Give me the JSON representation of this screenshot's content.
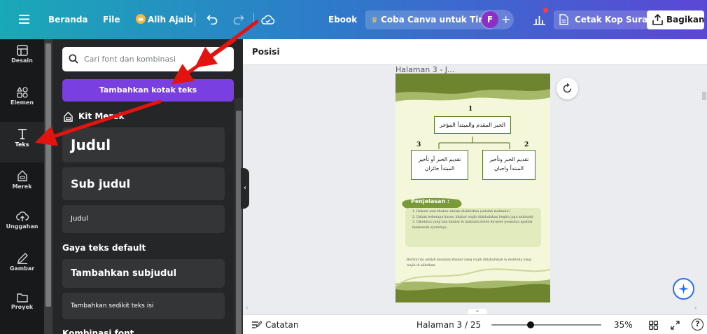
{
  "topbar": {
    "menu_icon": "hamburger-menu-icon",
    "home": "Beranda",
    "file": "File",
    "magic": "Alih Ajaib",
    "doc_type": "Ebook",
    "try_team": "Coba Canva untuk Tim",
    "avatar_initial": "F",
    "print": "Cetak Kop Surat",
    "share": "Bagikan"
  },
  "rail": [
    {
      "label": "Desain",
      "icon": "layout-icon"
    },
    {
      "label": "Elemen",
      "icon": "elements-icon"
    },
    {
      "label": "Teks",
      "icon": "text-icon"
    },
    {
      "label": "Merek",
      "icon": "brand-icon"
    },
    {
      "label": "Unggahan",
      "icon": "upload-icon"
    },
    {
      "label": "Gambar",
      "icon": "draw-icon"
    },
    {
      "label": "Proyek",
      "icon": "folder-icon"
    }
  ],
  "panel": {
    "search_placeholder": "Cari font dan kombinasi",
    "add_text_button": "Tambahkan kotak teks",
    "brand_kit": "Kit Merek",
    "brand_styles": [
      "Judul",
      "Sub judul",
      "Judul"
    ],
    "default_section": "Gaya teks default",
    "defaults": [
      "Tambahkan subjudul",
      "Tambahkan sedikit teks isi"
    ],
    "combo_section": "Kombinasi font"
  },
  "canvas": {
    "position_label": "Posisi",
    "page_header": "Halaman 3 - J...",
    "diagram": {
      "top_number": "1",
      "top_box": "الخبر المقدم والمبتدأ المؤخر",
      "left_number": "3",
      "left_box": [
        "تقديم الخبر أو تأخير",
        "المبتدأ جائزان"
      ],
      "right_number": "2",
      "right_box": [
        "تقديم الخبر وتأخير",
        "المبتدأ واجبان"
      ]
    },
    "explanation_title": "Penjelasan :",
    "explanation_items": [
      "1. Hukum asal khabar adalah diakhirkan (setelah mubtada')",
      "2. Dalam beberapa kasus, khabar wajib didahulukan begitu juga mubtada'",
      "3. Diketarui yang lain khabar & mubtada boleh diruiser posisinya apabila memenuhi syaratnya."
    ],
    "footnote": "Berikut ini adalah keadaan khabar yang wajib didahulukan & mubtada yang wajib di akhirkan"
  },
  "bottombar": {
    "notes": "Catatan",
    "page_indicator": "Halaman 3 / 25",
    "zoom": "35%",
    "zoom_level": 0.35,
    "help": "?"
  },
  "colors": {
    "accent_purple": "#7a3fe0",
    "page_green_dark": "#6f842f",
    "page_green_light": "#a6b96a",
    "annotation_arrow": "#e3140f"
  }
}
